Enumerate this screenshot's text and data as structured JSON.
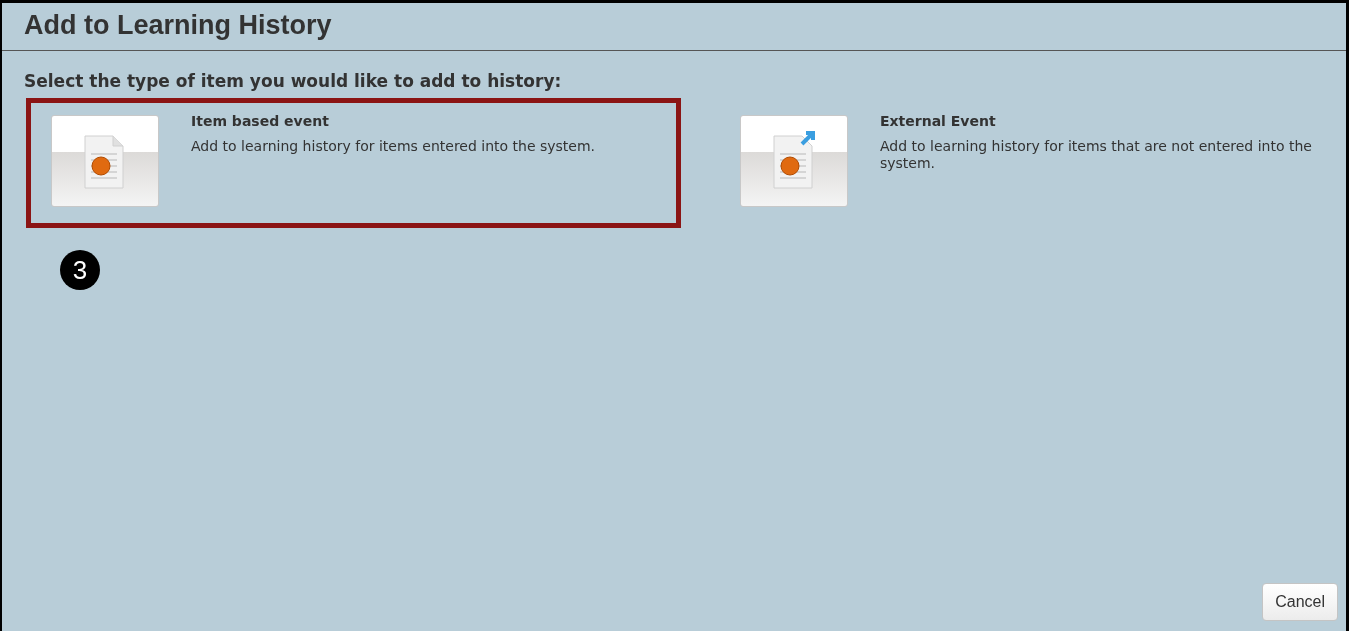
{
  "window": {
    "title": "Add to Learning History"
  },
  "prompt": "Select the type of item you would like to add to history:",
  "items": [
    {
      "kind": "item",
      "title": "Item based event",
      "description": "Add to learning history for items entered into the system.",
      "highlighted": true
    },
    {
      "kind": "external",
      "title": "External Event",
      "description": "Add to learning history for items that are not entered into the system.",
      "highlighted": false
    }
  ],
  "step_marker": "3",
  "buttons": [
    {
      "label": "Cancel"
    }
  ]
}
